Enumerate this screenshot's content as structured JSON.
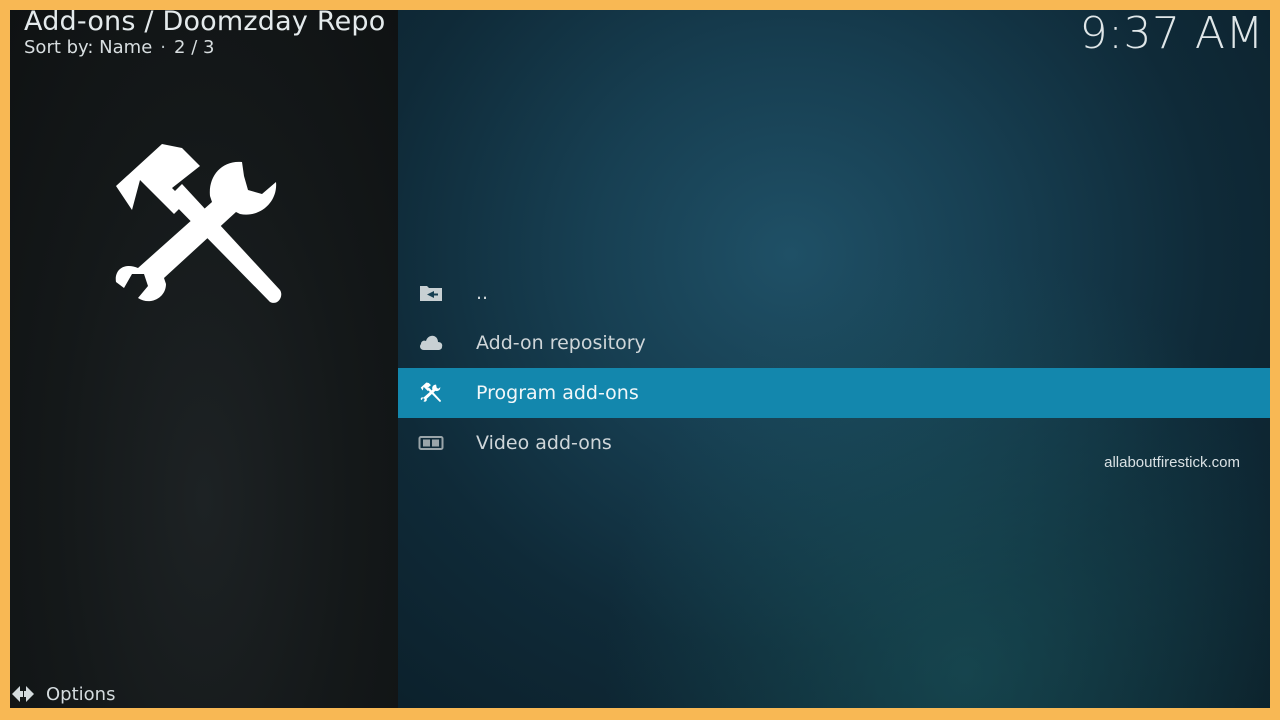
{
  "header": {
    "title": "Add-ons / Doomzday Repo",
    "sort_label": "Sort by: Name",
    "separator": "·",
    "position": "2 / 3"
  },
  "clock": "9:37 AM",
  "feature_icon": "tools-icon",
  "menu": {
    "items": [
      {
        "label": "..",
        "icon": "folder-back-icon",
        "selected": false
      },
      {
        "label": "Add-on repository",
        "icon": "cloud-icon",
        "selected": false
      },
      {
        "label": "Program add-ons",
        "icon": "tools-icon",
        "selected": true
      },
      {
        "label": "Video add-ons",
        "icon": "video-icon",
        "selected": false
      }
    ]
  },
  "watermark": "allaboutfirestick.com",
  "footer": {
    "options_label": "Options",
    "options_icon": "options-arrows-icon"
  },
  "colors": {
    "border": "#f8b854",
    "selection": "#1387ad",
    "right_panel": "#173f52",
    "left_panel": "#141819"
  }
}
